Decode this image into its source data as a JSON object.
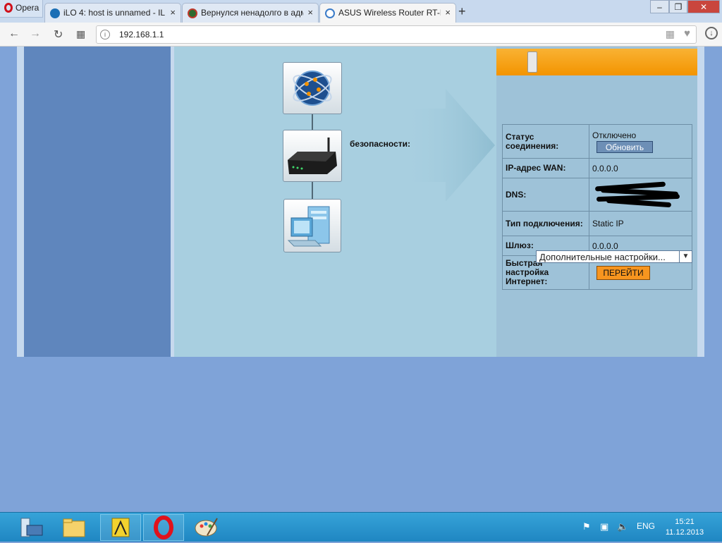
{
  "browser": {
    "menu_label": "Opera",
    "tabs": [
      {
        "title": "iLO 4: host is unnamed - IL",
        "close": "×"
      },
      {
        "title": "Вернулся ненадолго в адм",
        "close": "×"
      },
      {
        "title": "ASUS Wireless Router RT-N",
        "close": "×"
      }
    ],
    "new_tab": "+",
    "window_buttons": {
      "minimize": "–",
      "restore": "❐",
      "close": "✕"
    },
    "address": "192.168.1.1"
  },
  "router": {
    "security_label": "безопасности:",
    "status_rows": [
      {
        "label": "Статус соединения:",
        "value": "Отключено",
        "button": "Обновить"
      },
      {
        "label": "IP-адрес WAN:",
        "value": "0.0.0.0"
      },
      {
        "label": "DNS:",
        "value": ""
      },
      {
        "label": "Тип подключения:",
        "value": "Static IP"
      },
      {
        "label": "Шлюз:",
        "value": "0.0.0.0"
      },
      {
        "label": "Быстрая настройка Интернет:",
        "button": "ПЕРЕЙТИ"
      }
    ],
    "advanced_select": "Дополнительные настройки...",
    "colors": {
      "header": "#f5a623",
      "panel": "#9ec2d8",
      "main": "#a8cfe0",
      "sidebar": "#5f86bd"
    }
  },
  "taskbar": {
    "language": "ENG",
    "time": "15:21",
    "date": "11.12.2013"
  }
}
